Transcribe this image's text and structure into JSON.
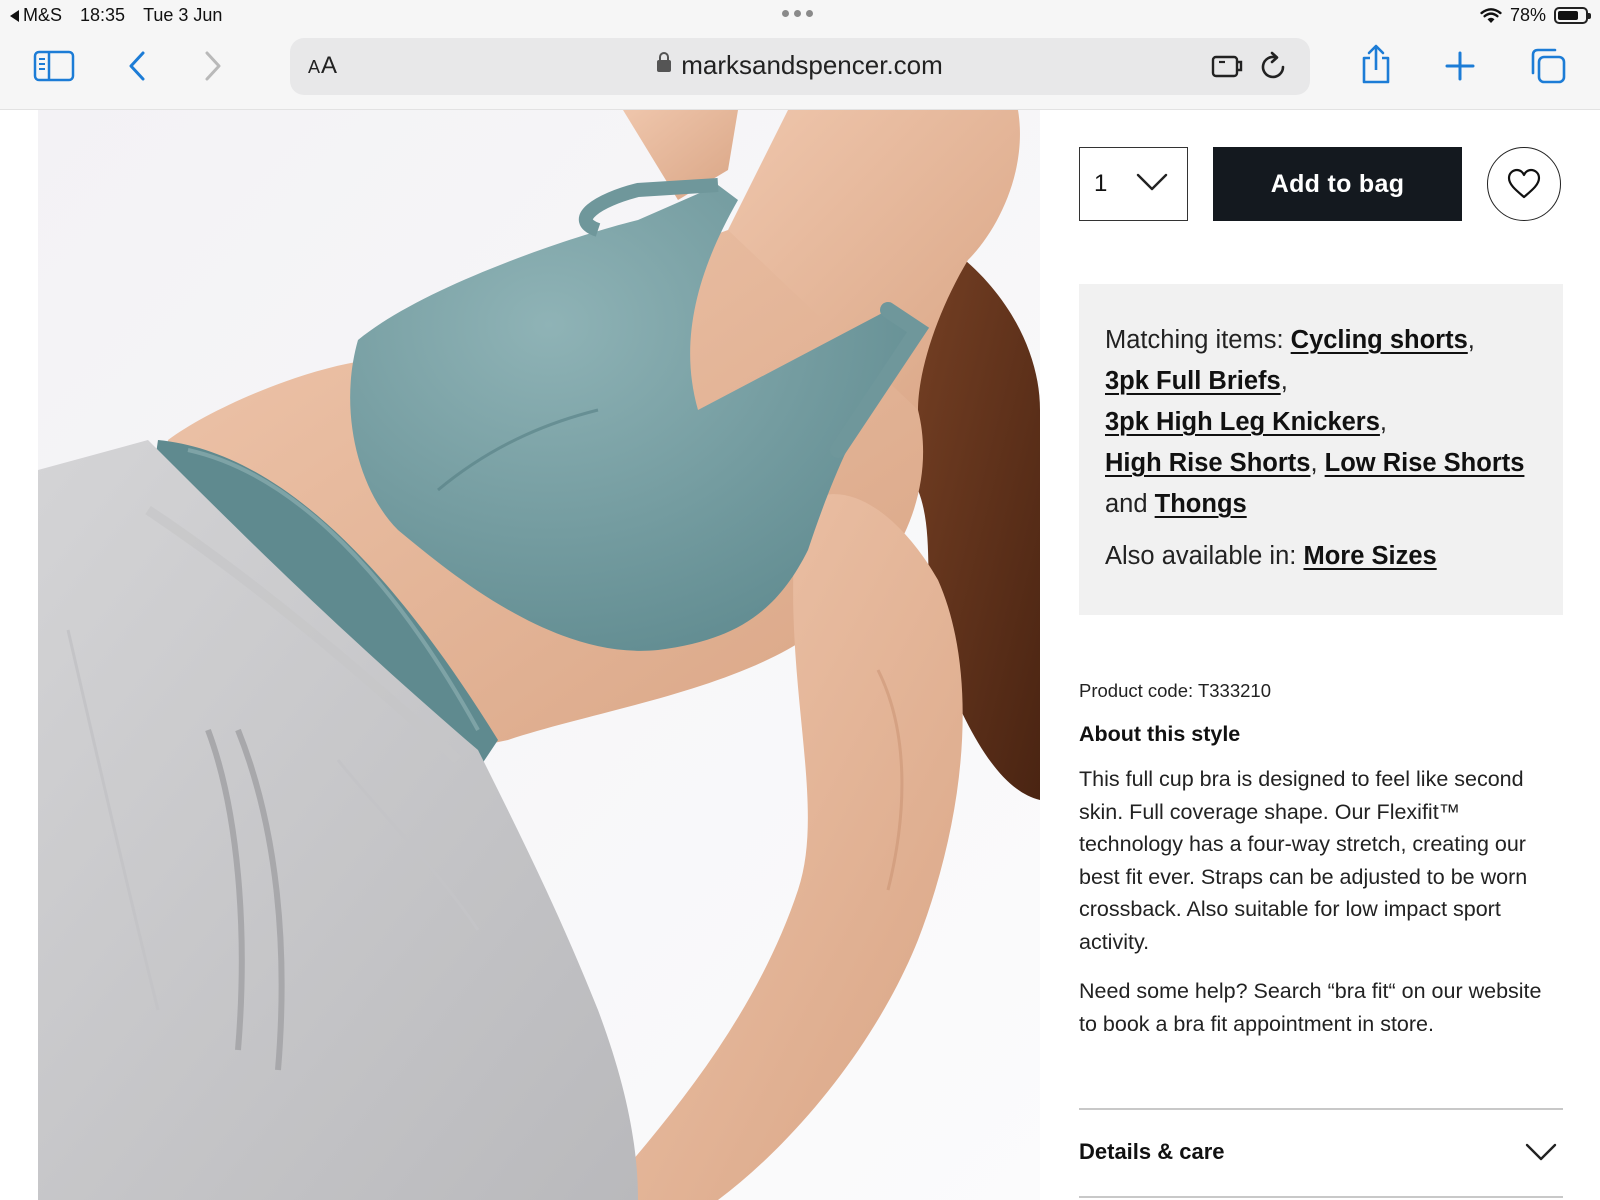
{
  "status_bar": {
    "back_app": "M&S",
    "time": "18:35",
    "date": "Tue 3 Jun",
    "battery": "78%",
    "battery_level": 0.78
  },
  "browser": {
    "text_size_label_small": "A",
    "text_size_label_large": "A",
    "url": "marksandspencer.com",
    "icons": [
      "sidebar-icon",
      "back-icon",
      "forward-icon",
      "lock-icon",
      "extension-icon",
      "reload-icon",
      "share-icon",
      "new-tab-icon",
      "tabs-icon"
    ]
  },
  "purchase": {
    "quantity": "1",
    "add_to_bag": "Add to bag"
  },
  "matching": {
    "prefix": "Matching items:",
    "links": [
      "Cycling shorts",
      "3pk Full Briefs",
      "3pk High Leg Knickers",
      "High Rise Shorts",
      "Low Rise Shorts",
      "Thongs"
    ],
    "comma": ",",
    "and": "and",
    "also_prefix": "Also available in:",
    "also_link": "More Sizes"
  },
  "product": {
    "code": "Product code: T333210",
    "about_heading": "About this style",
    "about_text": "This full cup bra is designed to feel like second skin. Full coverage shape. Our Flexifit™ technology has a four-way stretch, creating our best fit ever. Straps can be adjusted to be worn crossback. Also suitable for low impact sport activity.",
    "help_text": "Need some help? Search “bra fit“ on our website to book a bra fit appointment in store."
  },
  "details": {
    "label": "Details & care"
  },
  "colors": {
    "accent_blue": "#1c7cd6",
    "button_dark": "#14191f",
    "bra_teal": "#6f979b",
    "panel_grey": "#f1f1f1"
  }
}
